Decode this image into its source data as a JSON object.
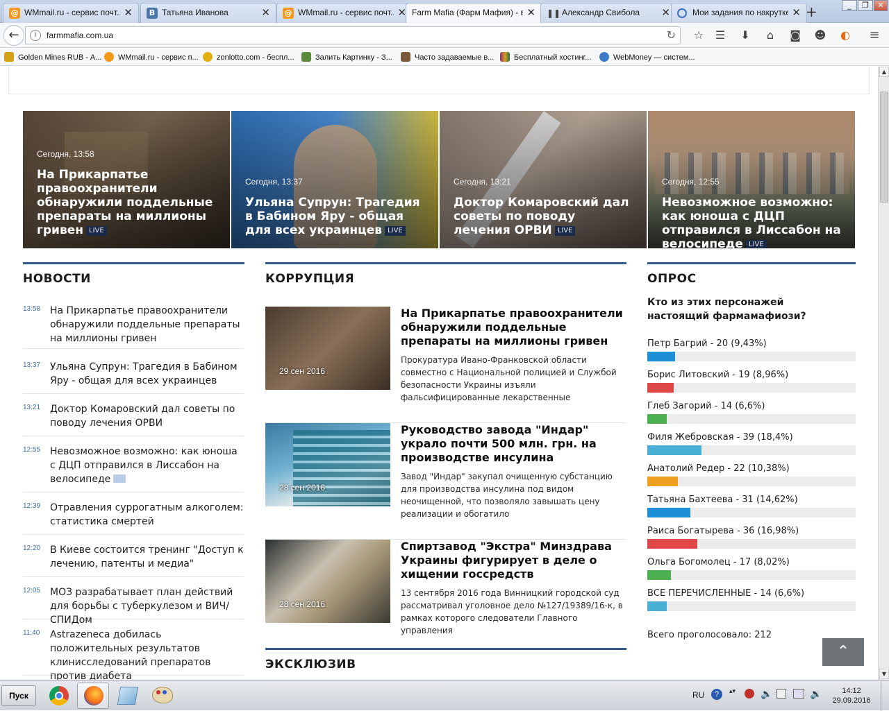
{
  "browser": {
    "tabs": [
      {
        "title": "WMmail.ru - сервис почт...",
        "icon": "at-icon",
        "color": "#f39a1c"
      },
      {
        "title": "Татьяна Иванова",
        "icon": "vk-icon",
        "color": "#4a76a8"
      },
      {
        "title": "WMmail.ru - сервис почт...",
        "icon": "at-icon",
        "color": "#f39a1c"
      },
      {
        "title": "Farm Mafia (Фарм Мафия) - в...",
        "icon": "",
        "color": ""
      },
      {
        "title": "Александр Свибола",
        "icon": "pause-icon",
        "color": "#444444"
      },
      {
        "title": "Мои задания по накрутке",
        "icon": "target-icon",
        "color": "#3c6fc4"
      }
    ],
    "url": "farmmafia.com.ua",
    "bookmarks": [
      {
        "label": "Golden Mines RUB - А...",
        "icon": "golden-mines-icon",
        "color": "#d4a017"
      },
      {
        "label": "WMmail.ru - сервис п...",
        "icon": "wmmail-icon",
        "color": "#f39a1c"
      },
      {
        "label": "zonlotto.com - беспл...",
        "icon": "zonlotto-icon",
        "color": "#e0b010"
      },
      {
        "label": "Залить Картинку - З...",
        "icon": "image-upload-icon",
        "color": "#5a8a3a"
      },
      {
        "label": "Часто задаваемые в...",
        "icon": "faq-icon",
        "color": "#7a5a3a"
      },
      {
        "label": "Бесплатный хостинг...",
        "icon": "hosting-icon",
        "color": "#8a2a6a"
      },
      {
        "label": "WebMoney — систем...",
        "icon": "webmoney-icon",
        "color": "#3a7ac8"
      }
    ]
  },
  "hero": [
    {
      "time": "Сегодня, 13:58",
      "title": "На Прикарпатье правоохранители обнаружили поддельные препараты на миллионы гривен",
      "live": "LIVE"
    },
    {
      "time": "Сегодня, 13:37",
      "title": "Ульяна Супрун: Трагедия в Бабином Яру - общая для всех украинцев",
      "live": "LIVE"
    },
    {
      "time": "Сегодня, 13:21",
      "title": "Доктор Комаровский дал советы по поводу лечения ОРВИ",
      "live": "LIVE"
    },
    {
      "time": "Сегодня, 12:55",
      "title": "Невозможное возможно: как юноша с ДЦП отправился в Лиссабон на велосипеде",
      "live": "LIVE"
    }
  ],
  "news": {
    "heading": "НОВОСТИ",
    "items": [
      {
        "time": "13:58",
        "text": "На Прикарпатье правоохранители обнаружили поддельные препараты на миллионы гривен"
      },
      {
        "time": "13:37",
        "text": "Ульяна Супрун: Трагедия в Бабином Яру - общая для всех украинцев"
      },
      {
        "time": "13:21",
        "text": "Доктор Комаровский дал советы по поводу лечения ОРВИ"
      },
      {
        "time": "12:55",
        "text": "Невозможное возможно: как юноша с ДЦП отправился в Лиссабон на велосипеде"
      },
      {
        "time": "12:39",
        "text": "Отравления суррогатным алкоголем: статистика смертей"
      },
      {
        "time": "12:20",
        "text": "В Киеве состоится тренинг \"Доступ к лечению, патенты и медиа\""
      },
      {
        "time": "12:05",
        "text": "МОЗ разрабатывает план действий для борьбы с туберкулезом и ВИЧ/СПИДом"
      },
      {
        "time": "11:40",
        "text": "Astrazeneca добилась положительных результатов клинисследований препаратов против диабета"
      }
    ]
  },
  "corruption": {
    "heading": "КОРРУПЦИЯ",
    "articles": [
      {
        "date": "29 сен 2016",
        "title": "На Прикарпатье правоохранители обнаружили поддельные препараты на миллионы гривен",
        "lead": "Прокуратура Ивано-Франковской области совместно с Национальной полицией и Службой безопасности Украины изъяли фальсифицированные лекарственные"
      },
      {
        "date": "28 сен 2016",
        "title": "Руководство завода \"Индар\" украло почти 500 млн. грн. на производстве инсулина",
        "lead": "Завод \"Индар\" закупал очищенную субстанцию для производства инсулина под видом неочищенной, что позволяло завышать цену реализации и обогатило"
      },
      {
        "date": "28 сен 2016",
        "title": "Спиртзавод \"Экстра\" Минздрава Украины фигурирует в деле о хищении госсредств",
        "lead": "13 сентября 2016 года Винницкий городской суд рассматривал уголовное дело №127/19389/16-к, в рамках которого следователи Главного управления"
      }
    ]
  },
  "exclusive": {
    "heading": "ЭКСКЛЮЗИВ"
  },
  "poll": {
    "heading": "ОПРОС",
    "question": "Кто из этих персонажей настоящий фармамафиози?",
    "options": [
      {
        "label": "Петр Багрий - 20 (9,43%)",
        "percent": 9.43,
        "color": "#1e8ed6"
      },
      {
        "label": "Борис Литовский - 19 (8,96%)",
        "percent": 8.96,
        "color": "#e04848"
      },
      {
        "label": "Глеб Загорий - 14 (6,6%)",
        "percent": 6.6,
        "color": "#4caf50"
      },
      {
        "label": "Филя Жебровская - 39 (18,4%)",
        "percent": 18.4,
        "color": "#4ab0d6"
      },
      {
        "label": "Анатолий Редер - 22 (10,38%)",
        "percent": 10.38,
        "color": "#f0a020"
      },
      {
        "label": "Татьяна Бахтеева - 31 (14,62%)",
        "percent": 14.62,
        "color": "#1e8ed6"
      },
      {
        "label": "Раиса Богатырева - 36 (16,98%)",
        "percent": 16.98,
        "color": "#e04848"
      },
      {
        "label": "Ольга Богомолец - 17 (8,02%)",
        "percent": 8.02,
        "color": "#4caf50"
      },
      {
        "label": "ВСЕ ПЕРЕЧИСЛЕННЫЕ - 14 (6,6%)",
        "percent": 6.6,
        "color": "#4ab0d6"
      }
    ],
    "total": "Всего проголосовало: 212"
  },
  "taskbar": {
    "start_label": "Пуск",
    "language": "RU",
    "time": "14:12",
    "date": "29.09.2016"
  }
}
